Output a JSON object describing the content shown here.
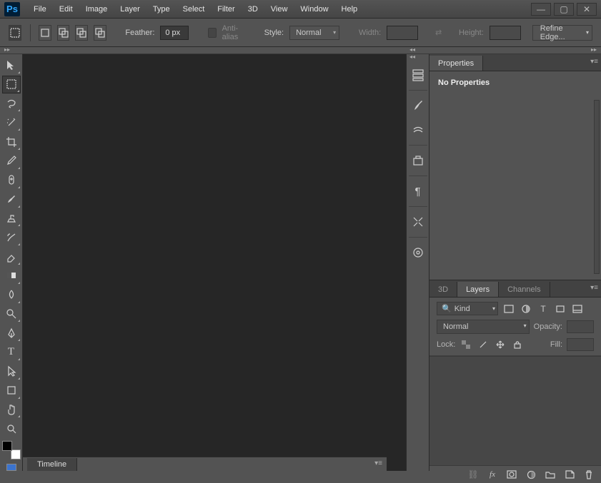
{
  "app": {
    "logo": "Ps"
  },
  "menu": [
    "File",
    "Edit",
    "Image",
    "Layer",
    "Type",
    "Select",
    "Filter",
    "3D",
    "View",
    "Window",
    "Help"
  ],
  "options": {
    "feather_label": "Feather:",
    "feather_value": "0 px",
    "antialias": "Anti-alias",
    "style_label": "Style:",
    "style_value": "Normal",
    "width_label": "Width:",
    "height_label": "Height:",
    "refine": "Refine Edge..."
  },
  "panels": {
    "properties_tab": "Properties",
    "no_props": "No Properties",
    "tabs_3d": "3D",
    "tabs_layers": "Layers",
    "tabs_channels": "Channels",
    "kind": "Kind",
    "blend": "Normal",
    "opacity_label": "Opacity:",
    "lock_label": "Lock:",
    "fill_label": "Fill:",
    "timeline": "Timeline"
  }
}
